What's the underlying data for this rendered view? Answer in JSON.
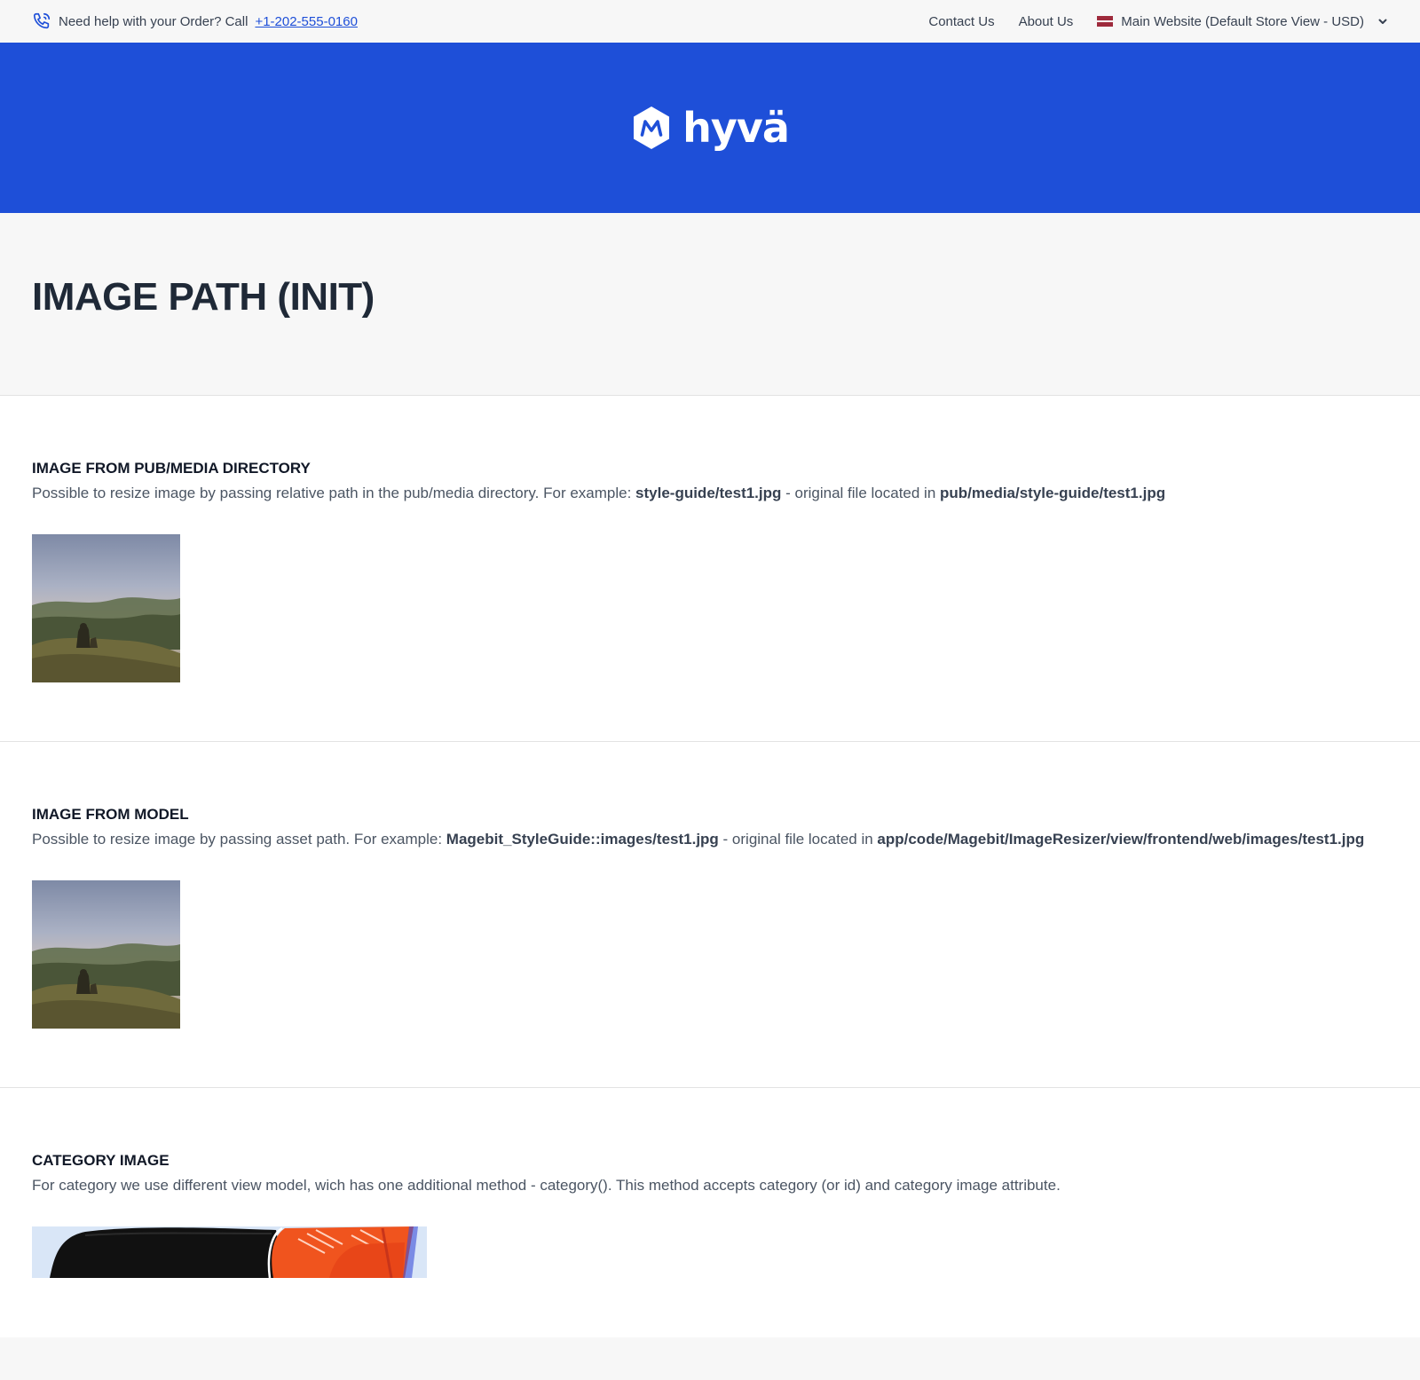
{
  "topbar": {
    "help_text": "Need help with your Order? Call",
    "phone": "+1-202-555-0160",
    "links": [
      "Contact Us",
      "About Us"
    ],
    "store": "Main Website (Default Store View - USD)"
  },
  "header": {
    "logo_text": "hyvä",
    "brand_color": "#1e4fd8"
  },
  "page": {
    "title": "IMAGE PATH (INIT)"
  },
  "sections": [
    {
      "title": "IMAGE FROM PUB/MEDIA DIRECTORY",
      "desc_prefix": "Possible to resize image by passing relative path in the pub/media directory. For example: ",
      "desc_code1": "style-guide/test1.jpg",
      "desc_middle": " - original file located in ",
      "desc_code2": "pub/media/style-guide/test1.jpg"
    },
    {
      "title": "IMAGE FROM MODEL",
      "desc_prefix": "Possible to resize image by passing asset path. For example: ",
      "desc_code1": "Magebit_StyleGuide::images/test1.jpg",
      "desc_middle": " - original file located in ",
      "desc_code2": "app/code/Magebit/ImageResizer/view/frontend/web/images/test1.jpg"
    },
    {
      "title": "CATEGORY IMAGE",
      "desc": "For category we use different view model, wich has one additional method - category(). This method accepts category (or id) and category image attribute."
    }
  ]
}
